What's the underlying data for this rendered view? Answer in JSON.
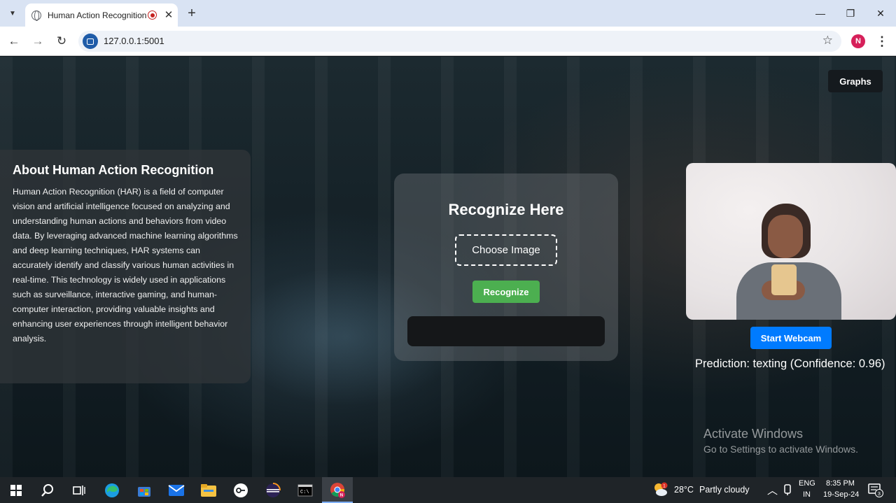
{
  "browser": {
    "tab_title": "Human Action Recognition",
    "url": "127.0.0.1:5001",
    "profile_initial": "N"
  },
  "page": {
    "graphs_label": "Graphs",
    "about": {
      "title": "About Human Action Recognition",
      "text": "Human Action Recognition (HAR) is a field of computer vision and artificial intelligence focused on analyzing and understanding human actions and behaviors from video data. By leveraging advanced machine learning algorithms and deep learning techniques, HAR systems can accurately identify and classify various human activities in real-time. This technology is widely used in applications such as surveillance, interactive gaming, and human-computer interaction, providing valuable insights and enhancing user experiences through intelligent behavior analysis."
    },
    "recognize": {
      "title": "Recognize Here",
      "choose_label": "Choose Image",
      "button_label": "Recognize"
    },
    "webcam": {
      "button_label": "Start Webcam",
      "prediction": "Prediction: texting (Confidence: 0.96)"
    },
    "activate": {
      "title": "Activate Windows",
      "subtitle": "Go to Settings to activate Windows."
    }
  },
  "taskbar": {
    "weather_temp": "28°C",
    "weather_desc": "Partly cloudy",
    "lang_top": "ENG",
    "lang_bottom": "IN",
    "time": "8:35 PM",
    "date": "19-Sep-24",
    "notification_count": "3",
    "weather_badge": "1"
  },
  "colors": {
    "recognize_green": "#4caf50",
    "webcam_blue": "#007bff",
    "recording_red": "#c5221f",
    "profile_pink": "#d6205a"
  }
}
